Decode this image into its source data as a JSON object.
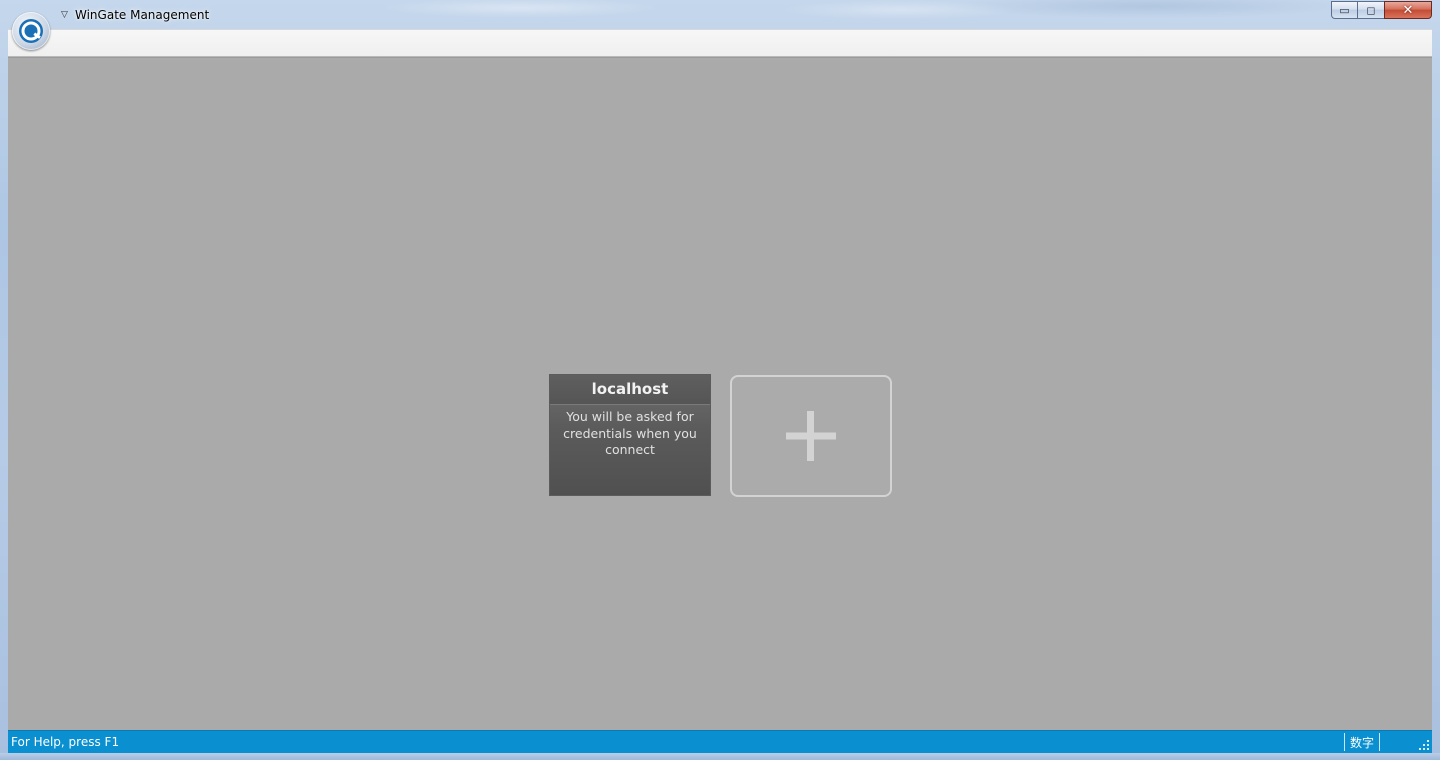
{
  "window": {
    "title": "WinGate Management",
    "controls": {
      "minimize": "▭",
      "maximize": "◻",
      "close": "✕"
    }
  },
  "servers": [
    {
      "name": "localhost",
      "description": "You will be asked for credentials when you connect"
    }
  ],
  "add_tile": {
    "icon": "plus-icon"
  },
  "statusbar": {
    "help_text": "For Help, press F1",
    "indicator": "数字"
  },
  "colors": {
    "client_bg": "#aaaaaa",
    "tile_bg": "#555555",
    "statusbar_bg": "#0a8fd0",
    "add_tile_border": "#d3d3d3"
  }
}
